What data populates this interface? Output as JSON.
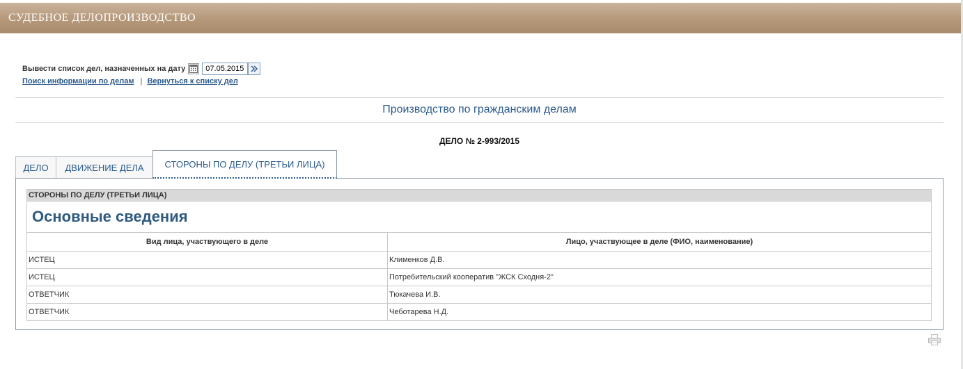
{
  "header": {
    "title": "СУДЕБНОЕ ДЕЛОПРОИЗВОДСТВО"
  },
  "date_picker": {
    "label": "Вывести список дел, назначенных на дату",
    "value": "07.05.2015",
    "calendar_icon": "calendar-icon",
    "go_icon": "double-arrow-icon"
  },
  "links": {
    "search": "Поиск информации по делам",
    "separator": "|",
    "back": "Вернуться к списку дел"
  },
  "section_title": "Производство по гражданским делам",
  "case_number": "ДЕЛО № 2-993/2015",
  "tabs": [
    {
      "label": "ДЕЛО",
      "active": false
    },
    {
      "label": "ДВИЖЕНИЕ ДЕЛА",
      "active": false
    },
    {
      "label": "СТОРОНЫ ПО ДЕЛУ (ТРЕТЬИ ЛИЦА)",
      "active": true
    }
  ],
  "parties": {
    "caption": "СТОРОНЫ ПО ДЕЛУ (ТРЕТЬИ ЛИЦА)",
    "heading": "Основные сведения",
    "columns": [
      "Вид лица, участвующего в деле",
      "Лицо, участвующее в деле (ФИО, наименование)"
    ],
    "rows": [
      [
        "ИСТЕЦ",
        "Клименков Д.В."
      ],
      [
        "ИСТЕЦ",
        "Потребительский кооператив \"ЖСК Сходня-2\""
      ],
      [
        "ОТВЕТЧИК",
        "Тюкачева И.В."
      ],
      [
        "ОТВЕТЧИК",
        "Чеботарева Н.Д."
      ]
    ]
  },
  "print_icon": "printer-icon"
}
